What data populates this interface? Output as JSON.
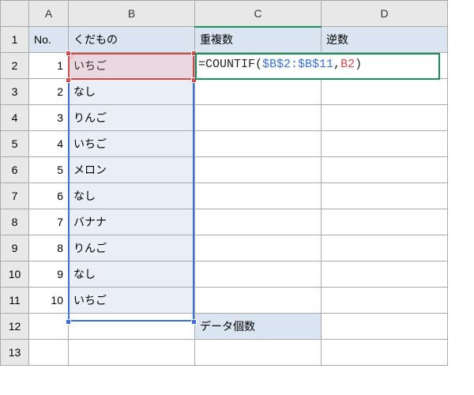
{
  "columns": {
    "A": "A",
    "B": "B",
    "C": "C",
    "D": "D"
  },
  "row_labels": [
    "1",
    "2",
    "3",
    "4",
    "5",
    "6",
    "7",
    "8",
    "9",
    "10",
    "11",
    "12",
    "13"
  ],
  "headers": {
    "A": "No.",
    "B": "くだもの",
    "C": "重複数",
    "D": "逆数"
  },
  "data": [
    {
      "no": "1",
      "fruit": "いちご"
    },
    {
      "no": "2",
      "fruit": "なし"
    },
    {
      "no": "3",
      "fruit": "りんご"
    },
    {
      "no": "4",
      "fruit": "いちご"
    },
    {
      "no": "5",
      "fruit": "メロン"
    },
    {
      "no": "6",
      "fruit": "なし"
    },
    {
      "no": "7",
      "fruit": "バナナ"
    },
    {
      "no": "8",
      "fruit": "りんご"
    },
    {
      "no": "9",
      "fruit": "なし"
    },
    {
      "no": "10",
      "fruit": "いちご"
    }
  ],
  "footer": {
    "label": "データ個数"
  },
  "formula": {
    "prefix": "=COUNTIF",
    "lparen": "(",
    "range": "$B$2:$B$11",
    "comma": ",",
    "ref": "B2",
    "rparen": ")"
  },
  "chart_data": {
    "type": "table",
    "title": "Excel worksheet with COUNTIF formula",
    "columns": [
      "No.",
      "くだもの",
      "重複数",
      "逆数"
    ],
    "rows": [
      [
        1,
        "いちご",
        "=COUNTIF($B$2:$B$11,B2)",
        ""
      ],
      [
        2,
        "なし",
        "",
        ""
      ],
      [
        3,
        "りんご",
        "",
        ""
      ],
      [
        4,
        "いちご",
        "",
        ""
      ],
      [
        5,
        "メロン",
        "",
        ""
      ],
      [
        6,
        "なし",
        "",
        ""
      ],
      [
        7,
        "バナナ",
        "",
        ""
      ],
      [
        8,
        "りんご",
        "",
        ""
      ],
      [
        9,
        "なし",
        "",
        ""
      ],
      [
        10,
        "いちご",
        "",
        ""
      ]
    ],
    "footer_row": [
      "",
      "",
      "データ個数",
      ""
    ]
  }
}
